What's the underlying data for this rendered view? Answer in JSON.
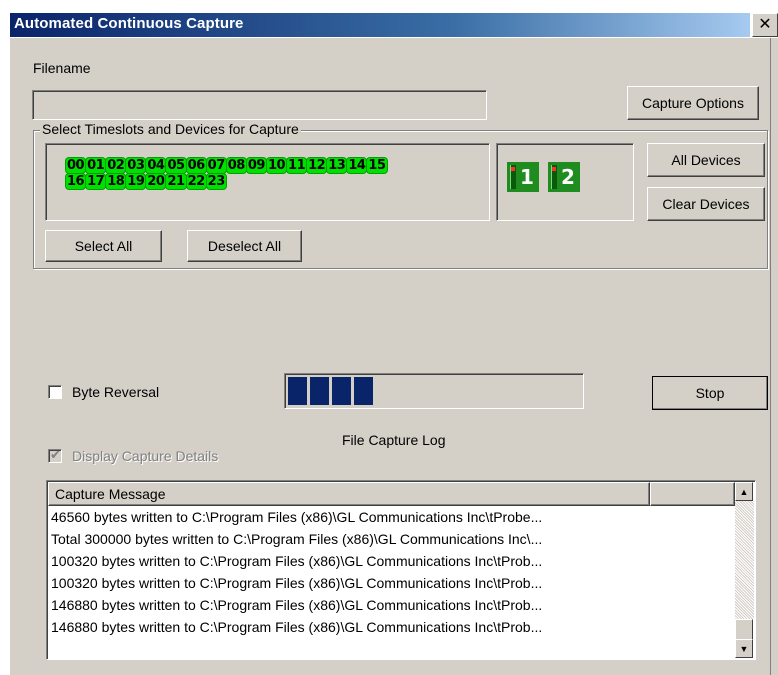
{
  "window": {
    "title": "Automated Continuous Capture",
    "close_glyph": "✕"
  },
  "filename": {
    "label": "Filename",
    "value": ""
  },
  "capture_options_button": "Capture Options",
  "timeslots_group": {
    "label": "Select Timeslots and Devices for Capture",
    "row1": [
      "00",
      "01",
      "02",
      "03",
      "04",
      "05",
      "06",
      "07",
      "08",
      "09",
      "10",
      "11",
      "12",
      "13",
      "14",
      "15"
    ],
    "row2": [
      "16",
      "17",
      "18",
      "19",
      "20",
      "21",
      "22",
      "23"
    ],
    "devices": [
      "1",
      "2"
    ],
    "select_all": "Select All",
    "deselect_all": "Deselect All"
  },
  "all_devices_button": "All Devices",
  "clear_devices_button": "Clear Devices",
  "byte_reversal": {
    "label": "Byte Reversal",
    "checked": false
  },
  "progress": {
    "chunks_filled": 4
  },
  "stop_button": "Stop",
  "file_capture_log_label": "File Capture Log",
  "display_capture_details": {
    "label": "Display Capture Details",
    "checked": true,
    "disabled": true
  },
  "log": {
    "header": "Capture Message",
    "rows": [
      "46560 bytes written to C:\\Program Files (x86)\\GL Communications Inc\\tProbe...",
      "Total 300000 bytes written to C:\\Program Files (x86)\\GL Communications Inc\\...",
      "100320 bytes written to C:\\Program Files (x86)\\GL Communications Inc\\tProb...",
      "100320 bytes written to C:\\Program Files (x86)\\GL Communications Inc\\tProb...",
      "146880 bytes written to C:\\Program Files (x86)\\GL Communications Inc\\tProb...",
      "146880 bytes written to C:\\Program Files (x86)\\GL Communications Inc\\tProb..."
    ]
  },
  "colors": {
    "title_gradient_start": "#0a246a",
    "timeslot_active": "#00e000",
    "device_green": "#1e8c1e",
    "progress_fill": "#0a246a"
  }
}
